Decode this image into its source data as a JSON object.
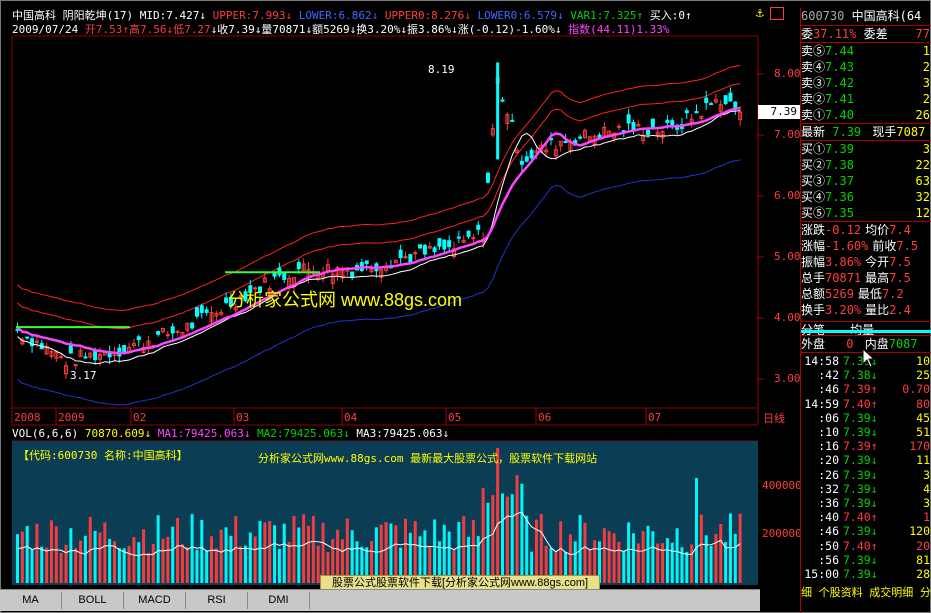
{
  "header": {
    "title": "中国高科",
    "indicator": "阴阳乾坤(17)",
    "mid": "MID:7.427",
    "upper": "UPPER:7.993",
    "lower": "LOWER:6.862",
    "upper0": "UPPER0:8.276",
    "lower0": "LOWER0:6.579",
    "var1": "VAR1:7.325",
    "buy_in": "买入:0"
  },
  "info": {
    "date": "2009/07/24",
    "open": "开7.53",
    "high": "高7.56",
    "low": "低7.27",
    "close": "收7.39",
    "volume": "量70871",
    "amount": "额5269",
    "turnover": "换3.20%",
    "amplitude": "振3.86%",
    "change": "涨(-0.12)-1.60%",
    "index": "指数(44.11)1.33%"
  },
  "price_axis": [
    "8.00",
    "7.00",
    "6.00",
    "5.00",
    "4.00",
    "3.00"
  ],
  "time_axis": [
    "2008",
    "2009",
    "02",
    "03",
    "04",
    "05",
    "06",
    "07"
  ],
  "price_tag": "7.39",
  "annotations": {
    "high": "8.19",
    "low": "3.17"
  },
  "watermark": {
    "main": "分析家公式网 www.88gs.com",
    "vol_left": "【代码:600730 名称:中国高科】",
    "vol_mid": "分析家公式网www.88gs.com 最新最大股票公式，股票软件下载网站",
    "banner": "股票公式股票软件下载[分析家公式网www.88gs.com]"
  },
  "vol_header": {
    "vol": "VOL(6,6,6)",
    "value": "70870.609",
    "ma1": "MA1:79425.063",
    "ma2": "MA2:79425.063",
    "ma3": "MA3:79425.063"
  },
  "vol_axis": [
    "400000",
    "200000"
  ],
  "day_label": "日线",
  "tabs": [
    "MA",
    "BOLL",
    "MACD",
    "RSI",
    "DMI"
  ],
  "right_panel": {
    "code": "600730",
    "name": "中国高科(64",
    "wei_bi": "委",
    "wei_bi_val": "37.11%",
    "wei_cha": "委差",
    "wei_cha_val": "77",
    "sells": [
      {
        "label": "卖⑤",
        "price": "7.44",
        "vol": "1"
      },
      {
        "label": "卖④",
        "price": "7.43",
        "vol": "2"
      },
      {
        "label": "卖③",
        "price": "7.42",
        "vol": "3"
      },
      {
        "label": "卖②",
        "price": "7.41",
        "vol": "2"
      },
      {
        "label": "卖①",
        "price": "7.40",
        "vol": "26"
      }
    ],
    "latest": "最新",
    "latest_val": "7.39",
    "now_hand": "现手",
    "now_hand_val": "7087",
    "buys": [
      {
        "label": "买①",
        "price": "7.39",
        "vol": "3"
      },
      {
        "label": "买②",
        "price": "7.38",
        "vol": "22"
      },
      {
        "label": "买③",
        "price": "7.37",
        "vol": "63"
      },
      {
        "label": "买④",
        "price": "7.36",
        "vol": "32"
      },
      {
        "label": "买⑤",
        "price": "7.35",
        "vol": "12"
      }
    ],
    "stats": [
      {
        "k1": "涨跌",
        "v1": "-0.12",
        "k2": "均价",
        "v2": "7.4"
      },
      {
        "k1": "涨幅",
        "v1": "-1.60%",
        "k2": "前收",
        "v2": "7.5"
      },
      {
        "k1": "振幅",
        "v1": "3.86%",
        "k2": "今开",
        "v2": "7.5"
      },
      {
        "k1": "总手",
        "v1": "70871",
        "k2": "最高",
        "v2": "7.5"
      },
      {
        "k1": "总额",
        "v1": "5269",
        "k2": "最低",
        "v2": "7.2"
      },
      {
        "k1": "换手",
        "v1": "3.20%",
        "k2": "量比",
        "v2": "2.4"
      }
    ],
    "fenbi": "分笔",
    "junliang": "均量",
    "waipan": "外盘",
    "waipan_val": "0",
    "neipan": "内盘",
    "neipan_val": "7087",
    "ticks": [
      {
        "t": "14:58",
        "p": "7.39",
        "a": "↓",
        "v": "10"
      },
      {
        "t": ":42",
        "p": "7.38",
        "a": "↓",
        "v": "25"
      },
      {
        "t": ":46",
        "p": "7.39",
        "a": "↑",
        "v": "0.70"
      },
      {
        "t": "14:59",
        "p": "7.40",
        "a": "↑",
        "v": "80"
      },
      {
        "t": ":06",
        "p": "7.39",
        "a": "↓",
        "v": "45"
      },
      {
        "t": ":10",
        "p": "7.39",
        "a": "↓",
        "v": "51"
      },
      {
        "t": ":16",
        "p": "7.39",
        "a": "↑",
        "v": "170"
      },
      {
        "t": ":20",
        "p": "7.39",
        "a": "↓",
        "v": "11"
      },
      {
        "t": ":26",
        "p": "7.39",
        "a": "↓",
        "v": "3"
      },
      {
        "t": ":32",
        "p": "7.39",
        "a": "↓",
        "v": "4"
      },
      {
        "t": ":36",
        "p": "7.39",
        "a": "↓",
        "v": "3"
      },
      {
        "t": ":40",
        "p": "7.40",
        "a": "↑",
        "v": "1"
      },
      {
        "t": ":46",
        "p": "7.39",
        "a": "↓",
        "v": "120"
      },
      {
        "t": ":50",
        "p": "7.40",
        "a": "↑",
        "v": "20"
      },
      {
        "t": ":56",
        "p": "7.39",
        "a": "↓",
        "v": "81"
      },
      {
        "t": "15:00",
        "p": "7.39",
        "a": "↓",
        "v": "28"
      }
    ],
    "footer": "细 个股资料 成交明细 分时走势"
  },
  "colors": {
    "up": "#ff3c3c",
    "down": "#00ffff",
    "mid": "#ff44ff",
    "var1": "#ffffff",
    "band": "#ff2020",
    "lowband": "#2233cc",
    "flat": "#33ff33"
  }
}
